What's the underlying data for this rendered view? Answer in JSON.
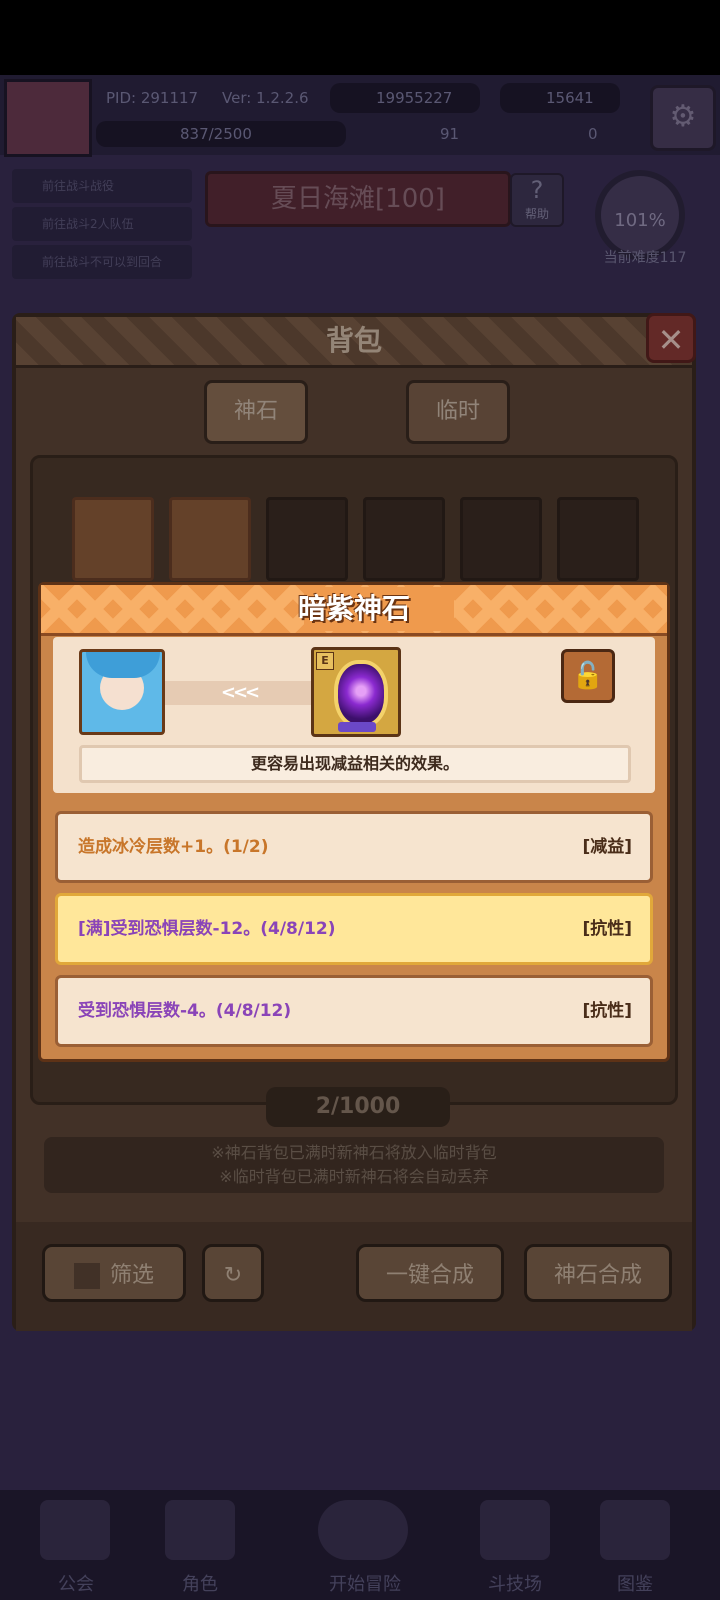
{
  "hud": {
    "pid": "PID: 291117",
    "version": "Ver: 1.2.2.6",
    "currency1": "19955227",
    "currency2": "15641",
    "exp": "837/2500",
    "res1": "91",
    "res2": "0"
  },
  "quests": [
    "前往战斗战役",
    "前往战斗2人队伍",
    "前往战斗不可以到回合"
  ],
  "stage": {
    "title": "夏日海滩[100]",
    "help": "帮助",
    "percent": "101%",
    "difficulty": "当前难度117"
  },
  "backpack": {
    "title": "背包",
    "tabs": [
      "神石",
      "临时"
    ],
    "count": "2/1000",
    "notice_line1": "※神石背包已满时新神石将放入临时背包",
    "notice_line2": "※临时背包已满时新神石将会自动丢弃",
    "buttons": {
      "filter": "筛选",
      "one_click": "一键合成",
      "gem_merge": "神石合成"
    }
  },
  "popup": {
    "title": "暗紫神石",
    "arrow": "<<<",
    "gem_grade": "E",
    "lock_icon": "unlock-icon",
    "description": "更容易出现减益相关的效果。",
    "effects": [
      {
        "text": "造成冰冷层数+1。(1/2)",
        "tag": "[减益]",
        "color": "#c8762a",
        "style": "normal"
      },
      {
        "text": "[满]受到恐惧层数-12。(4/8/12)",
        "tag": "[抗性]",
        "color": "#8a44b8",
        "style": "max"
      },
      {
        "text": "受到恐惧层数-4。(4/8/12)",
        "tag": "[抗性]",
        "color": "#8a44b8",
        "style": "normal"
      }
    ]
  },
  "nav": [
    "公会",
    "角色",
    "开始冒险",
    "斗技场",
    "图鉴"
  ]
}
